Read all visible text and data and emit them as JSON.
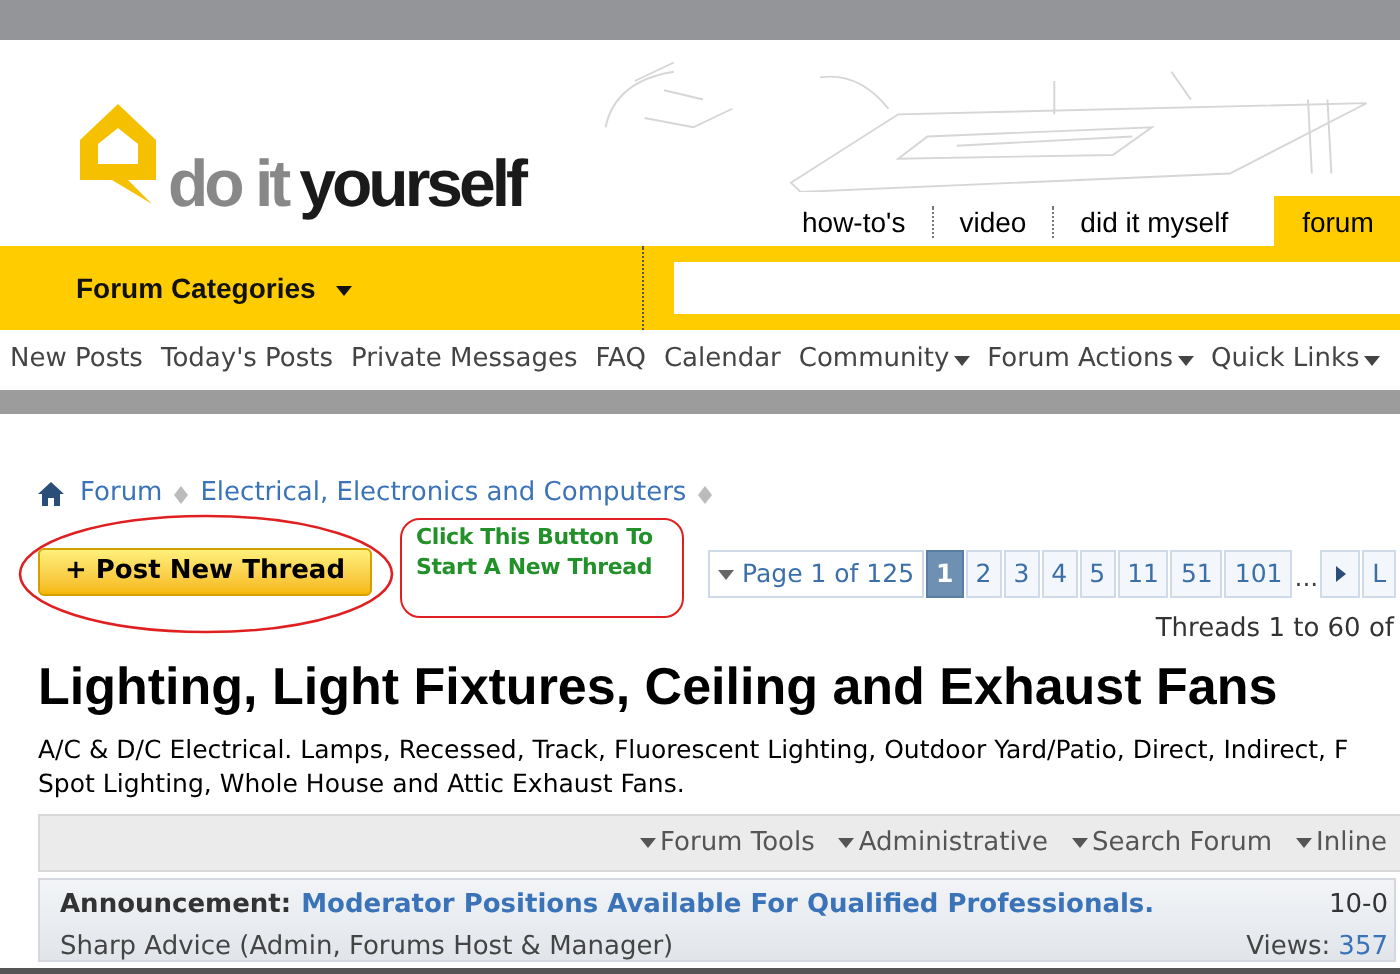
{
  "logo": {
    "words": [
      "do it",
      "yourself"
    ]
  },
  "site_tabs": [
    {
      "label": "how-to's",
      "selected": false
    },
    {
      "label": "video",
      "selected": false
    },
    {
      "label": "did it myself",
      "selected": false
    },
    {
      "label": "forum",
      "selected": true
    }
  ],
  "category_bar": {
    "label": "Forum Categories"
  },
  "nav": [
    {
      "label": "New Posts",
      "dropdown": false
    },
    {
      "label": "Today's Posts",
      "dropdown": false
    },
    {
      "label": "Private Messages",
      "dropdown": false
    },
    {
      "label": "FAQ",
      "dropdown": false
    },
    {
      "label": "Calendar",
      "dropdown": false
    },
    {
      "label": "Community",
      "dropdown": true
    },
    {
      "label": "Forum Actions",
      "dropdown": true
    },
    {
      "label": "Quick Links",
      "dropdown": true
    }
  ],
  "breadcrumb": [
    "Forum",
    "Electrical, Electronics and Computers"
  ],
  "post_button": {
    "label": "+ Post New Thread"
  },
  "callout": {
    "text": "Click This Button To Start A New Thread"
  },
  "pagination": {
    "label": "Page 1 of 125",
    "pages": [
      {
        "label": "1",
        "selected": true
      },
      {
        "label": "2",
        "selected": false
      },
      {
        "label": "3",
        "selected": false
      },
      {
        "label": "4",
        "selected": false
      },
      {
        "label": "5",
        "selected": false
      },
      {
        "label": "11",
        "selected": false
      },
      {
        "label": "51",
        "selected": false
      },
      {
        "label": "101",
        "selected": false
      }
    ],
    "ellipsis": "...",
    "last": "L"
  },
  "thread_count": "Threads 1 to 60 of",
  "title": "Lighting, Light Fixtures, Ceiling and Exhaust Fans",
  "description_lines": [
    "A/C & D/C Electrical. Lamps, Recessed, Track, Fluorescent Lighting, Outdoor Yard/Patio, Direct, Indirect, F",
    "Spot Lighting, Whole House and Attic Exhaust Fans."
  ],
  "toolbar": [
    "Forum Tools",
    "Administrative",
    "Search Forum",
    "Inline"
  ],
  "announcement": {
    "label": "Announcement:",
    "title": "Moderator Positions Available For Qualified Professionals.",
    "date": "10-0",
    "author": "Sharp Advice (Admin, Forums Host & Manager)",
    "views_label": "Views:",
    "views": "357"
  }
}
